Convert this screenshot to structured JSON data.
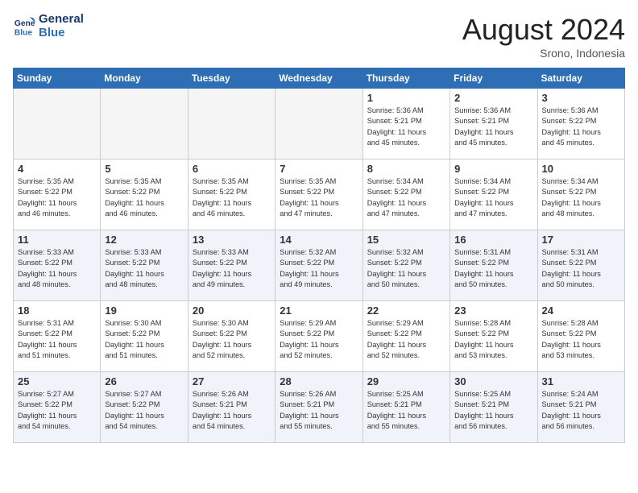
{
  "header": {
    "logo_line1": "General",
    "logo_line2": "Blue",
    "month_year": "August 2024",
    "location": "Srono, Indonesia"
  },
  "weekdays": [
    "Sunday",
    "Monday",
    "Tuesday",
    "Wednesday",
    "Thursday",
    "Friday",
    "Saturday"
  ],
  "weeks": [
    [
      {
        "day": "",
        "info": ""
      },
      {
        "day": "",
        "info": ""
      },
      {
        "day": "",
        "info": ""
      },
      {
        "day": "",
        "info": ""
      },
      {
        "day": "1",
        "info": "Sunrise: 5:36 AM\nSunset: 5:21 PM\nDaylight: 11 hours\nand 45 minutes."
      },
      {
        "day": "2",
        "info": "Sunrise: 5:36 AM\nSunset: 5:21 PM\nDaylight: 11 hours\nand 45 minutes."
      },
      {
        "day": "3",
        "info": "Sunrise: 5:36 AM\nSunset: 5:22 PM\nDaylight: 11 hours\nand 45 minutes."
      }
    ],
    [
      {
        "day": "4",
        "info": "Sunrise: 5:35 AM\nSunset: 5:22 PM\nDaylight: 11 hours\nand 46 minutes."
      },
      {
        "day": "5",
        "info": "Sunrise: 5:35 AM\nSunset: 5:22 PM\nDaylight: 11 hours\nand 46 minutes."
      },
      {
        "day": "6",
        "info": "Sunrise: 5:35 AM\nSunset: 5:22 PM\nDaylight: 11 hours\nand 46 minutes."
      },
      {
        "day": "7",
        "info": "Sunrise: 5:35 AM\nSunset: 5:22 PM\nDaylight: 11 hours\nand 47 minutes."
      },
      {
        "day": "8",
        "info": "Sunrise: 5:34 AM\nSunset: 5:22 PM\nDaylight: 11 hours\nand 47 minutes."
      },
      {
        "day": "9",
        "info": "Sunrise: 5:34 AM\nSunset: 5:22 PM\nDaylight: 11 hours\nand 47 minutes."
      },
      {
        "day": "10",
        "info": "Sunrise: 5:34 AM\nSunset: 5:22 PM\nDaylight: 11 hours\nand 48 minutes."
      }
    ],
    [
      {
        "day": "11",
        "info": "Sunrise: 5:33 AM\nSunset: 5:22 PM\nDaylight: 11 hours\nand 48 minutes."
      },
      {
        "day": "12",
        "info": "Sunrise: 5:33 AM\nSunset: 5:22 PM\nDaylight: 11 hours\nand 48 minutes."
      },
      {
        "day": "13",
        "info": "Sunrise: 5:33 AM\nSunset: 5:22 PM\nDaylight: 11 hours\nand 49 minutes."
      },
      {
        "day": "14",
        "info": "Sunrise: 5:32 AM\nSunset: 5:22 PM\nDaylight: 11 hours\nand 49 minutes."
      },
      {
        "day": "15",
        "info": "Sunrise: 5:32 AM\nSunset: 5:22 PM\nDaylight: 11 hours\nand 50 minutes."
      },
      {
        "day": "16",
        "info": "Sunrise: 5:31 AM\nSunset: 5:22 PM\nDaylight: 11 hours\nand 50 minutes."
      },
      {
        "day": "17",
        "info": "Sunrise: 5:31 AM\nSunset: 5:22 PM\nDaylight: 11 hours\nand 50 minutes."
      }
    ],
    [
      {
        "day": "18",
        "info": "Sunrise: 5:31 AM\nSunset: 5:22 PM\nDaylight: 11 hours\nand 51 minutes."
      },
      {
        "day": "19",
        "info": "Sunrise: 5:30 AM\nSunset: 5:22 PM\nDaylight: 11 hours\nand 51 minutes."
      },
      {
        "day": "20",
        "info": "Sunrise: 5:30 AM\nSunset: 5:22 PM\nDaylight: 11 hours\nand 52 minutes."
      },
      {
        "day": "21",
        "info": "Sunrise: 5:29 AM\nSunset: 5:22 PM\nDaylight: 11 hours\nand 52 minutes."
      },
      {
        "day": "22",
        "info": "Sunrise: 5:29 AM\nSunset: 5:22 PM\nDaylight: 11 hours\nand 52 minutes."
      },
      {
        "day": "23",
        "info": "Sunrise: 5:28 AM\nSunset: 5:22 PM\nDaylight: 11 hours\nand 53 minutes."
      },
      {
        "day": "24",
        "info": "Sunrise: 5:28 AM\nSunset: 5:22 PM\nDaylight: 11 hours\nand 53 minutes."
      }
    ],
    [
      {
        "day": "25",
        "info": "Sunrise: 5:27 AM\nSunset: 5:22 PM\nDaylight: 11 hours\nand 54 minutes."
      },
      {
        "day": "26",
        "info": "Sunrise: 5:27 AM\nSunset: 5:22 PM\nDaylight: 11 hours\nand 54 minutes."
      },
      {
        "day": "27",
        "info": "Sunrise: 5:26 AM\nSunset: 5:21 PM\nDaylight: 11 hours\nand 54 minutes."
      },
      {
        "day": "28",
        "info": "Sunrise: 5:26 AM\nSunset: 5:21 PM\nDaylight: 11 hours\nand 55 minutes."
      },
      {
        "day": "29",
        "info": "Sunrise: 5:25 AM\nSunset: 5:21 PM\nDaylight: 11 hours\nand 55 minutes."
      },
      {
        "day": "30",
        "info": "Sunrise: 5:25 AM\nSunset: 5:21 PM\nDaylight: 11 hours\nand 56 minutes."
      },
      {
        "day": "31",
        "info": "Sunrise: 5:24 AM\nSunset: 5:21 PM\nDaylight: 11 hours\nand 56 minutes."
      }
    ]
  ]
}
